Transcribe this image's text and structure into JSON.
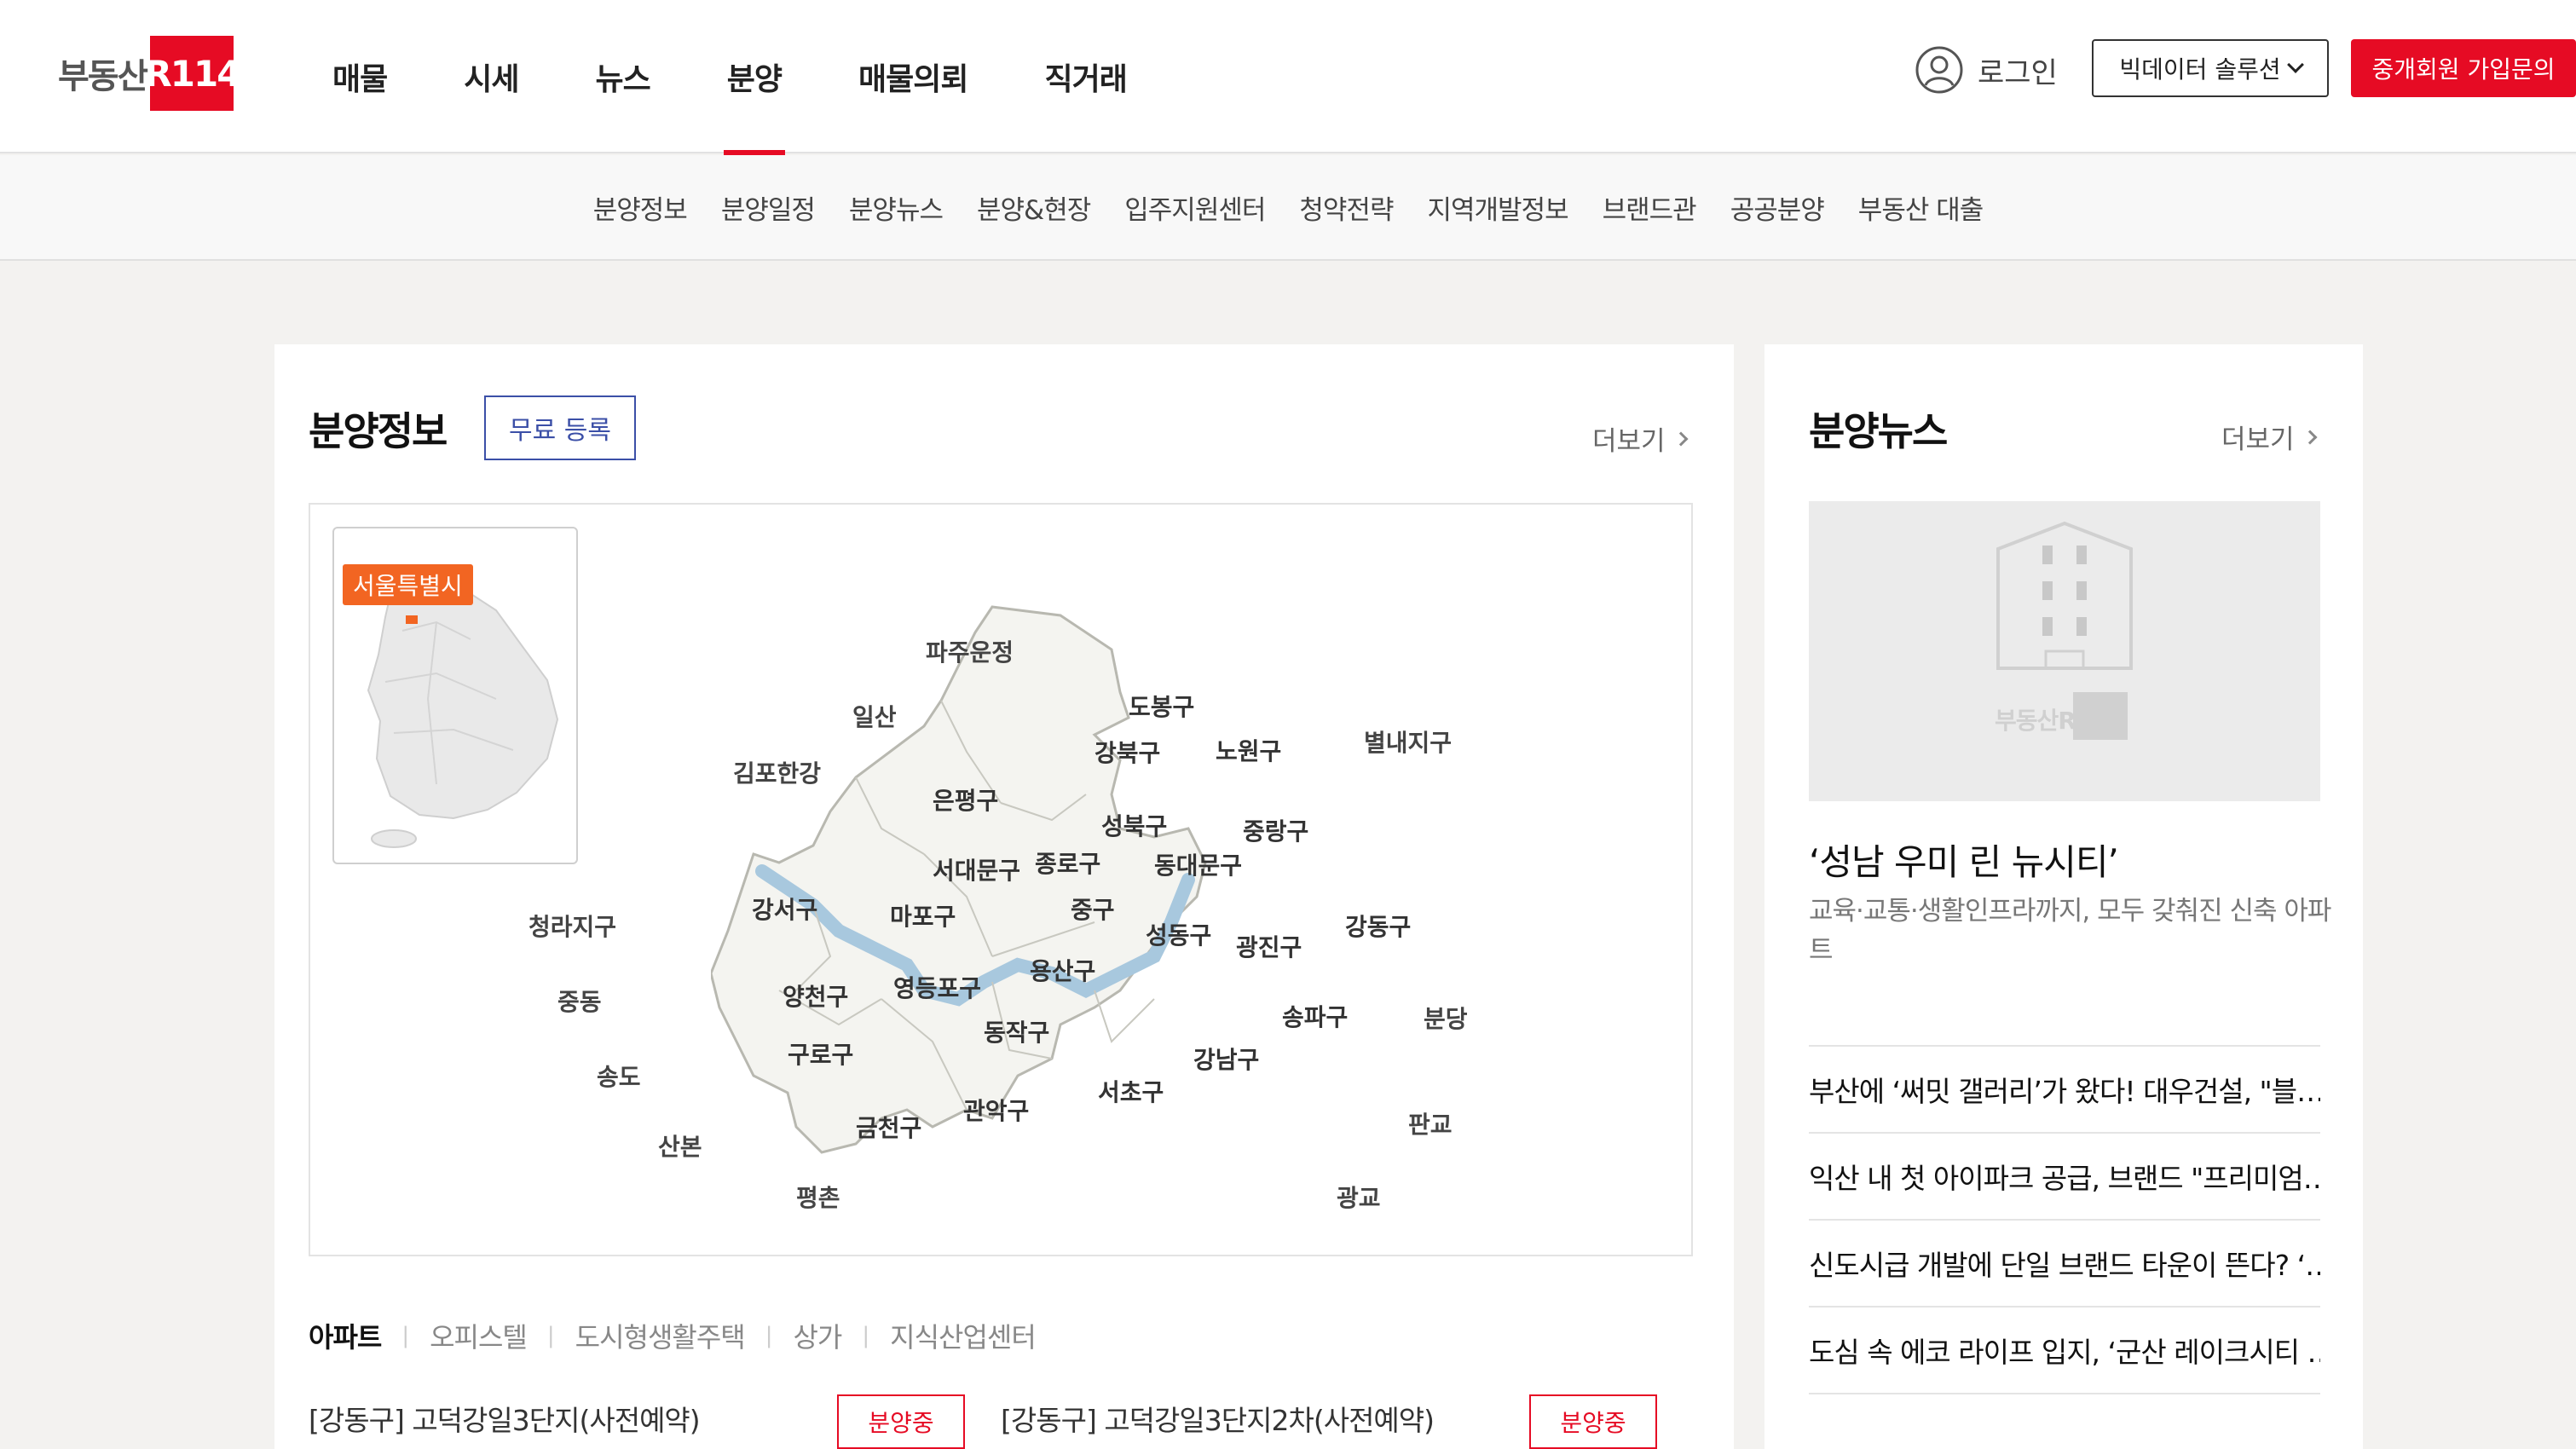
{
  "header": {
    "logo_text": "부동산",
    "logo_badge": "R114",
    "nav": [
      "매물",
      "시세",
      "뉴스",
      "분양",
      "매물의뢰",
      "직거래"
    ],
    "active_nav": "분양",
    "login_label": "로그인",
    "bigdata_label": "빅데이터 솔루션",
    "join_label": "중개회원 가입문의"
  },
  "subnav": [
    "분양정보",
    "분양일정",
    "분양뉴스",
    "분양&현장",
    "입주지원센터",
    "청약전략",
    "지역개발정보",
    "브랜드관",
    "공공분양",
    "부동산 대출"
  ],
  "sale_info": {
    "title": "분양정보",
    "register_label": "무료 등록",
    "more_label": "더보기",
    "map": {
      "mini_label": "서울특별시",
      "districts": [
        "도봉구",
        "노원구",
        "강북구",
        "은평구",
        "성북구",
        "중랑구",
        "종로구",
        "서대문구",
        "동대문구",
        "강서구",
        "마포구",
        "중구",
        "성동구",
        "광진구",
        "강동구",
        "용산구",
        "양천구",
        "영등포구",
        "동작구",
        "송파구",
        "구로구",
        "강남구",
        "서초구",
        "관악구",
        "금천구"
      ],
      "outer_areas": [
        "파주운정",
        "일산",
        "김포한강",
        "별내지구",
        "청라지구",
        "중동",
        "송도",
        "산본",
        "평촌",
        "분당",
        "판교",
        "광교"
      ],
      "river_color": "#a8c8de"
    },
    "type_tabs": [
      "아파트",
      "오피스텔",
      "도시형생활주택",
      "상가",
      "지식산업센터"
    ],
    "active_tab": "아파트",
    "listings": [
      {
        "name": "[강동구] 고덕강일3단지(사전예약)",
        "status": "분양중"
      },
      {
        "name": "[강동구] 고덕강일3단지2차(사전예약)",
        "status": "분양중"
      }
    ]
  },
  "news": {
    "title": "분양뉴스",
    "more_label": "더보기",
    "image_logo": "부동산R114",
    "headline": "‘성남 우미 린 뉴시티’",
    "desc": "교육·교통·생활인프라까지, 모두 갖춰진 신축 아파트",
    "items": [
      "부산에 ‘써밋 갤러리’가 왔다! 대우건설, \"블…",
      "익산 내 첫 아이파크 공급, 브랜드 \"프리미엄…",
      "신도시급 개발에 단일 브랜드 타운이 뜬다? ‘…",
      "도심 속 에코 라이프 입지, ‘군산 레이크시티 …"
    ]
  },
  "colors": {
    "brand": "#e60b24",
    "accent_blue": "#3b4fa7",
    "tag_orange": "#f26522"
  }
}
